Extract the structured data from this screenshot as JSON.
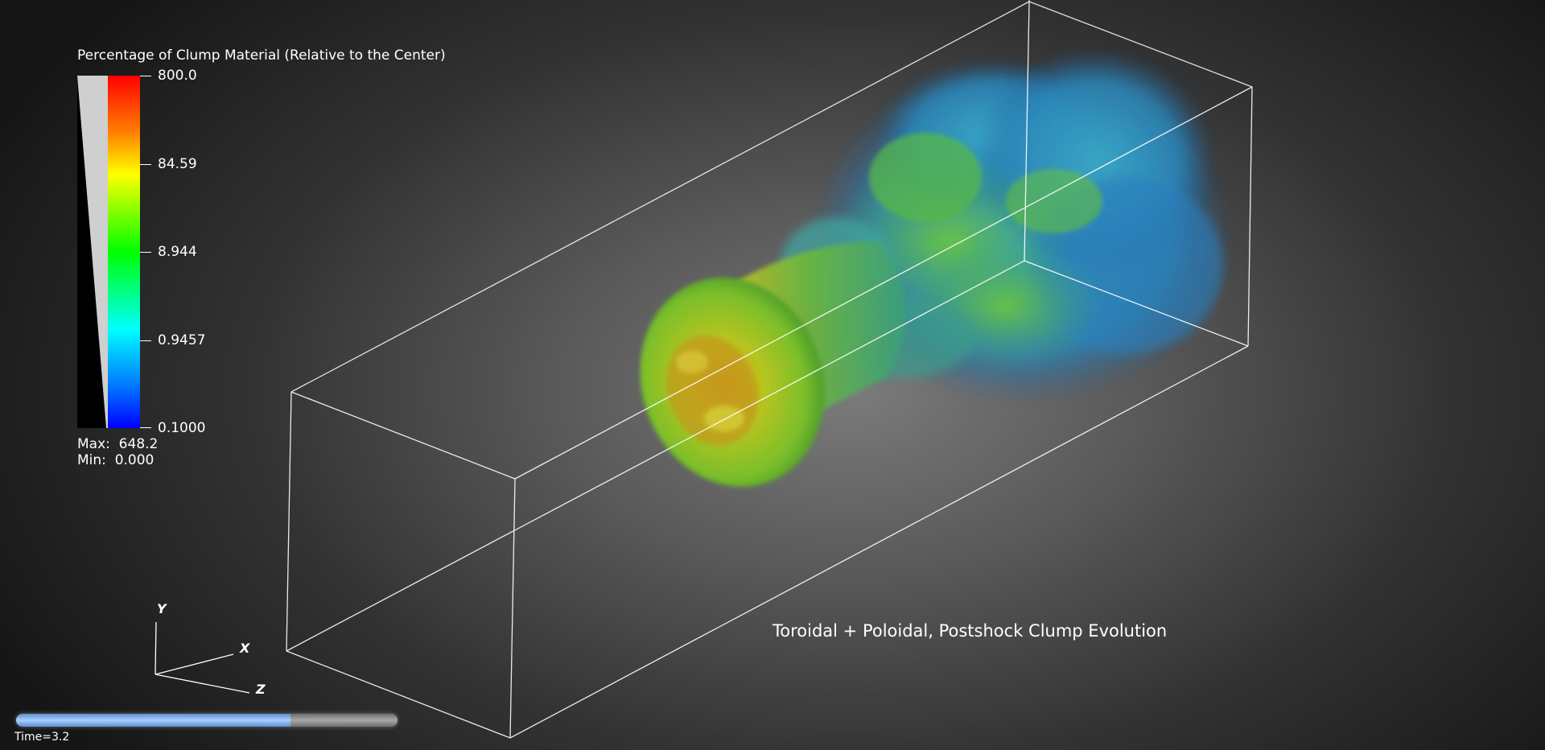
{
  "colorbar": {
    "title": "Percentage of Clump Material (Relative to the Center)",
    "ticks": [
      "800.0",
      "84.59",
      "8.944",
      "0.9457",
      "0.1000"
    ],
    "max_label": "Max:  648.2",
    "min_label": "Min:  0.000"
  },
  "axes": {
    "x": "X",
    "y": "Y",
    "z": "Z"
  },
  "caption": "Toroidal + Poloidal, Postshock Clump Evolution",
  "time": {
    "label": "Time=3.2",
    "progress": 0.72
  },
  "colors": {
    "box_lines": "#ffffff",
    "colormap": [
      "#ff0000",
      "#ff7f00",
      "#ffff00",
      "#00ff00",
      "#00ffff",
      "#0000ff"
    ]
  }
}
